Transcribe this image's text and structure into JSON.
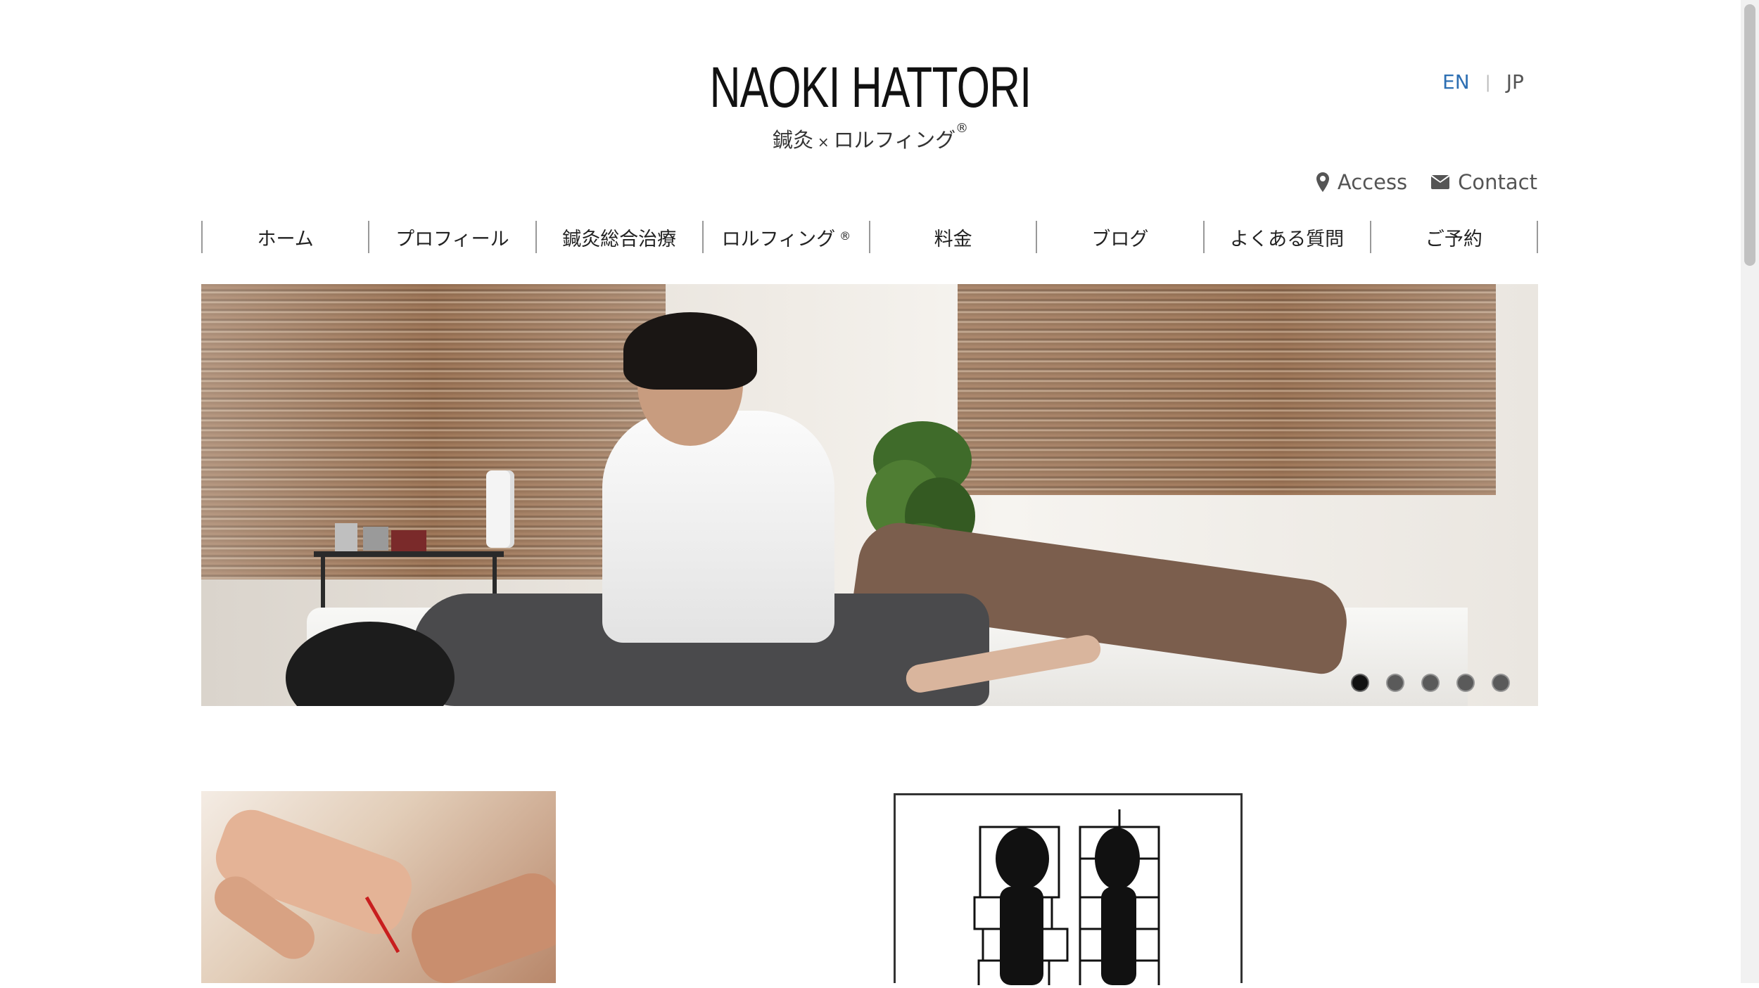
{
  "header": {
    "title": "NAOKI HATTORI",
    "subtitle_left": "鍼灸",
    "subtitle_times": "×",
    "subtitle_right": "ロルフィング",
    "subtitle_reg": "®"
  },
  "language": {
    "en": "EN",
    "separator": "|",
    "jp": "JP",
    "active": "EN",
    "active_color": "#2d6fb3"
  },
  "utility_links": {
    "access": "Access",
    "access_icon": "map-pin-icon",
    "contact": "Contact",
    "contact_icon": "envelope-icon"
  },
  "nav": {
    "items": [
      {
        "label": "ホーム"
      },
      {
        "label": "プロフィール"
      },
      {
        "label": "鍼灸総合治療"
      },
      {
        "label": "ロルフィング",
        "reg": "®"
      },
      {
        "label": "料金"
      },
      {
        "label": "ブログ"
      },
      {
        "label": "よくある質問"
      },
      {
        "label": "ご予約"
      }
    ]
  },
  "slider": {
    "slide_count": 5,
    "active_index": 0
  }
}
